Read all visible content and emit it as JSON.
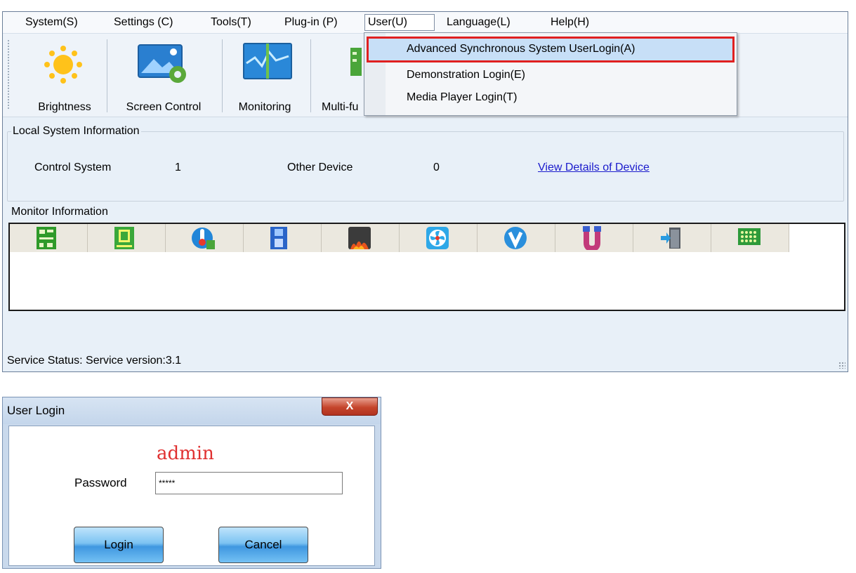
{
  "menu": {
    "system": "System(S)",
    "settings": "Settings (C)",
    "tools": "Tools(T)",
    "plugin": "Plug-in (P)",
    "user": "User(U)",
    "language": "Language(L)",
    "help": "Help(H)"
  },
  "toolbar": {
    "brightness": "Brightness",
    "screen_control": "Screen Control",
    "monitoring": "Monitoring",
    "multi_function": "Multi-fu"
  },
  "user_menu": {
    "items": [
      "Advanced Synchronous System UserLogin(A)",
      "Demonstration Login(E)",
      "Media Player Login(T)"
    ],
    "highlight_color": "#e02020"
  },
  "local_info": {
    "title": "Local System Information",
    "control_system_label": "Control System",
    "control_system_value": "1",
    "other_device_label": "Other Device",
    "other_device_value": "0",
    "details_link": "View Details of Device"
  },
  "monitor": {
    "title": "Monitor Information",
    "icons": [
      "receiving-card-icon",
      "sending-card-icon",
      "temperature-icon",
      "multifunction-card-icon",
      "smoke-icon",
      "fan-icon",
      "voltage-icon",
      "cable-icon",
      "door-icon",
      "module-icon"
    ]
  },
  "status": {
    "text": "Service Status:  Service version:3.1"
  },
  "login": {
    "title": "User Login",
    "close": "X",
    "user": "admin",
    "password_label": "Password",
    "password_value": "*****",
    "login_button": "Login",
    "cancel_button": "Cancel"
  }
}
